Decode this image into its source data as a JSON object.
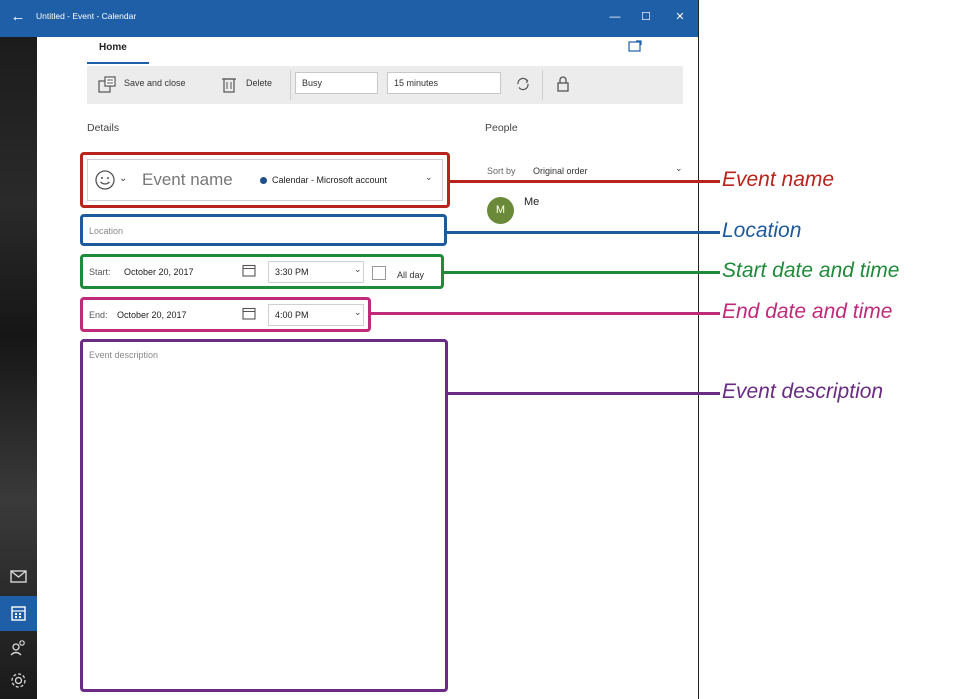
{
  "window": {
    "title": "Untitled - Event - Calendar",
    "back_glyph": "←",
    "minimize_glyph": "—",
    "maximize_glyph": "☐",
    "close_glyph": "✕"
  },
  "tabs": {
    "home": "Home"
  },
  "toolbar": {
    "save_close": "Save and close",
    "delete": "Delete",
    "show_as": "Busy",
    "reminder": "15 minutes"
  },
  "sections": {
    "details": "Details",
    "people": "People"
  },
  "event": {
    "name_placeholder": "Event name",
    "calendar": "Calendar - Microsoft account",
    "calendar_color": "#1e4f8a",
    "location_placeholder": "Location",
    "start_label": "Start:",
    "start_date": "October 20, 2017",
    "start_time": "3:30 PM",
    "all_day": "All day",
    "end_label": "End:",
    "end_date": "October 20, 2017",
    "end_time": "4:00 PM",
    "description_placeholder": "Event description"
  },
  "people": {
    "sort_label": "Sort by",
    "sort_value": "Original order",
    "attendee_initial": "M",
    "attendee_name": "Me"
  },
  "annotations": {
    "event_name": "Event name",
    "location": "Location",
    "start": "Start date and time",
    "end": "End date and time",
    "description": "Event description"
  },
  "colors": {
    "accent": "#1e5fa8",
    "annotation_red": "#b8231b",
    "annotation_blue": "#1d5a9c",
    "annotation_green": "#1f8a3a",
    "annotation_pink": "#c02a7a",
    "annotation_purple": "#6a2b82"
  },
  "icons": {
    "mail": "mail-icon",
    "calendar": "calendar-icon",
    "people": "people-icon",
    "settings": "settings-icon"
  }
}
